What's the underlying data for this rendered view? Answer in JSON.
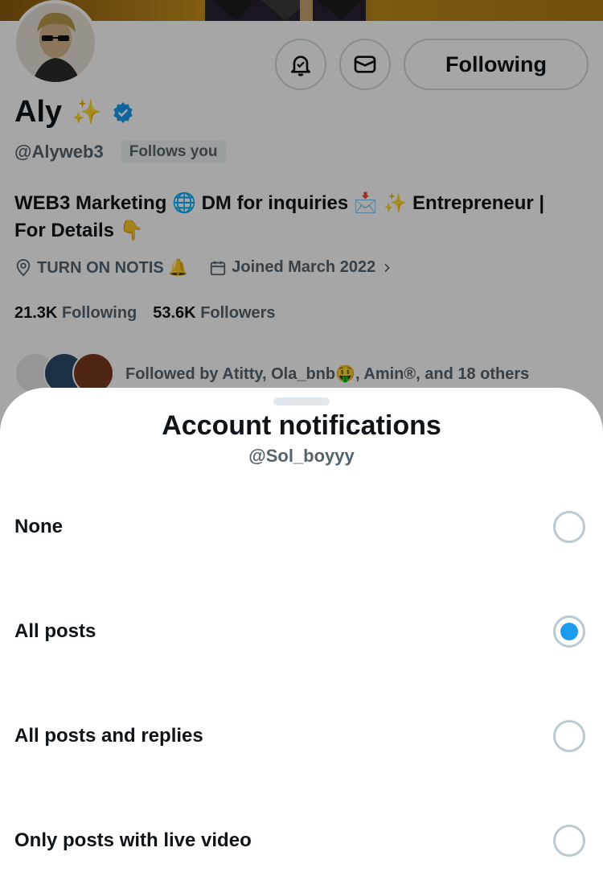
{
  "profile": {
    "name": "Aly",
    "name_emoji": "✨",
    "handle": "@Alyweb3",
    "follows_you": "Follows you",
    "follow_button": "Following",
    "bio_line1": "WEB3 Marketing 🌐 DM for inquiries 📩 ✨ Entrepreneur |",
    "bio_line2": "For Details 👇",
    "location": "TURN ON NOTIS 🔔",
    "joined": "Joined March 2022",
    "following_count": "21.3K",
    "following_label": "Following",
    "followers_count": "53.6K",
    "followers_label": "Followers",
    "followed_by": "Followed by Atitty, Ola_bnb🤑, Amin®, and 18 others",
    "verified_color": "#1d9bf0"
  },
  "sheet": {
    "title": "Account notifications",
    "subtitle": "@Sol_boyyy",
    "options": [
      {
        "label": "None",
        "selected": false
      },
      {
        "label": "All posts",
        "selected": true
      },
      {
        "label": "All posts and replies",
        "selected": false
      },
      {
        "label": "Only posts with live video",
        "selected": false
      }
    ],
    "accent_color": "#1d9bf0"
  }
}
